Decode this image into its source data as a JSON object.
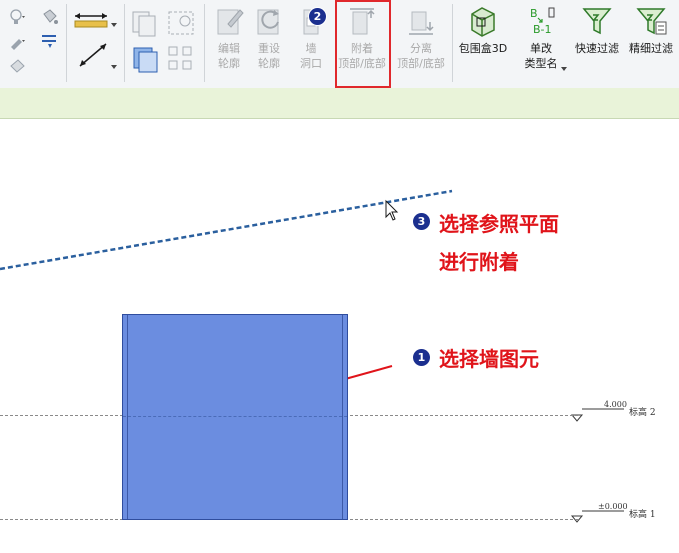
{
  "ribbon": {
    "buttons": [
      {
        "id": "edit_profile",
        "label1": "编辑",
        "label2": "轮廓",
        "enabled": false
      },
      {
        "id": "reset_profile",
        "label1": "重设",
        "label2": "轮廓",
        "enabled": false
      },
      {
        "id": "wall_opening",
        "label1": "墙",
        "label2": "洞口",
        "enabled": false
      },
      {
        "id": "attach",
        "label1": "附着",
        "label2": "顶部/底部",
        "enabled": false
      },
      {
        "id": "detach",
        "label1": "分离",
        "label2": "顶部/底部",
        "enabled": false
      },
      {
        "id": "bounding_box",
        "label1": "包围盒3D",
        "label2": "",
        "enabled": true
      },
      {
        "id": "rename_type",
        "label1": "单改",
        "label2": "类型名",
        "enabled": true
      },
      {
        "id": "quick_filter",
        "label1": "快速过滤",
        "label2": "",
        "enabled": true
      },
      {
        "id": "fine_filter",
        "label1": "精细过滤",
        "label2": "",
        "enabled": true
      }
    ],
    "rename_icon_text": {
      "top": "B",
      "bottom": "B-1"
    }
  },
  "badges": {
    "one": "1",
    "two": "2",
    "three": "3"
  },
  "annotations": {
    "step3_line1": "选择参照平面",
    "step3_line2": "进行附着",
    "step1": "选择墙图元"
  },
  "levels": [
    {
      "name": "标高 2",
      "elevation": "4.000"
    },
    {
      "name": "标高 1",
      "elevation": "±0.000"
    }
  ],
  "colors": {
    "highlight": "#e0282c",
    "annotation": "#e0141a",
    "badge": "#1b2f8f",
    "wall": "#6b8de0",
    "ref_plane": "#2a5f9e"
  }
}
